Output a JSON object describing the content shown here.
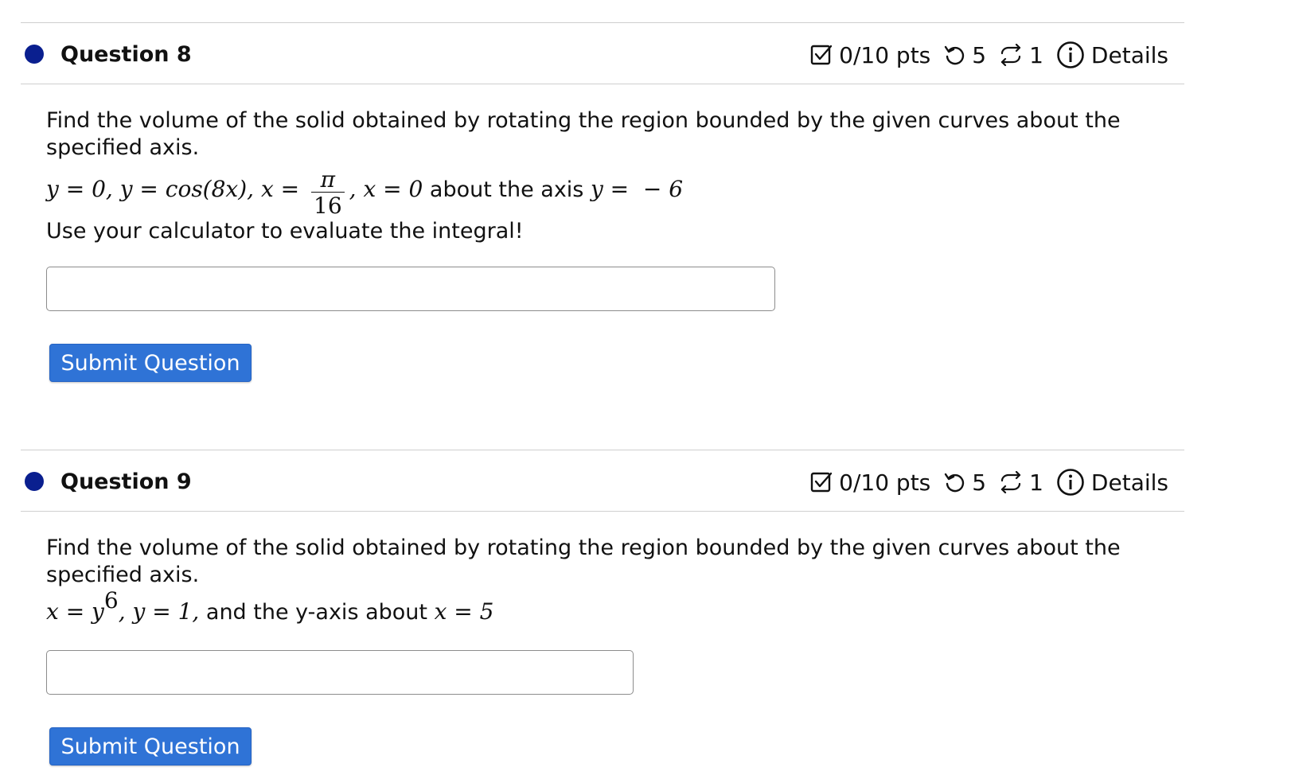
{
  "questions": [
    {
      "title": "Question 8",
      "points": "0/10 pts",
      "retries": "5",
      "submissions": "1",
      "details_label": "Details",
      "prompt_line1": "Find the volume of the solid obtained by rotating the region bounded by the given curves about the",
      "prompt_line2": "specified axis.",
      "math": {
        "part_a": "y = 0, y = cos(8x), x = ",
        "frac_num": "π",
        "frac_den": "16",
        "part_b": ", x = 0",
        "about_text": " about the axis ",
        "axis": "y =  − 6"
      },
      "instruction": "Use your calculator to evaluate the integral!",
      "answer_value": "",
      "submit_label": "Submit Question"
    },
    {
      "title": "Question 9",
      "points": "0/10 pts",
      "retries": "5",
      "submissions": "1",
      "details_label": "Details",
      "prompt_line1": "Find the volume of the solid obtained by rotating the region bounded by the given curves about the",
      "prompt_line2": "specified axis.",
      "math": {
        "part_a": "x = y",
        "exponent": "6",
        "part_b": ", y = 1,",
        "about_text": " and the y-axis about ",
        "axis": "x = 5"
      },
      "answer_value": "",
      "submit_label": "Submit Question"
    }
  ],
  "icons": {
    "points": "checkbox-check-icon",
    "retries": "retry-icon",
    "submissions": "sync-icon",
    "details": "info-circle-icon"
  },
  "colors": {
    "status_dot": "#0a1f8f",
    "submit_button": "#2f73d6",
    "divider": "#cfcfcf"
  }
}
